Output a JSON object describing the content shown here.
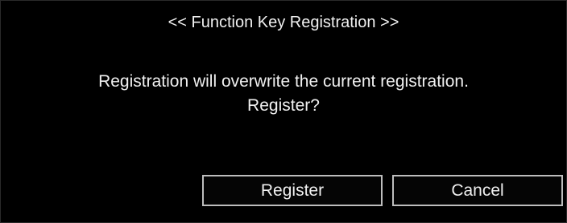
{
  "dialog": {
    "title": "<< Function Key Registration >>",
    "message_line1": "Registration will overwrite the current registration.",
    "message_line2": "Register?",
    "register_label": "Register",
    "cancel_label": "Cancel"
  },
  "colors": {
    "background": "#000000",
    "text": "#f0f0f0",
    "button_border": "#bdbdbd"
  }
}
